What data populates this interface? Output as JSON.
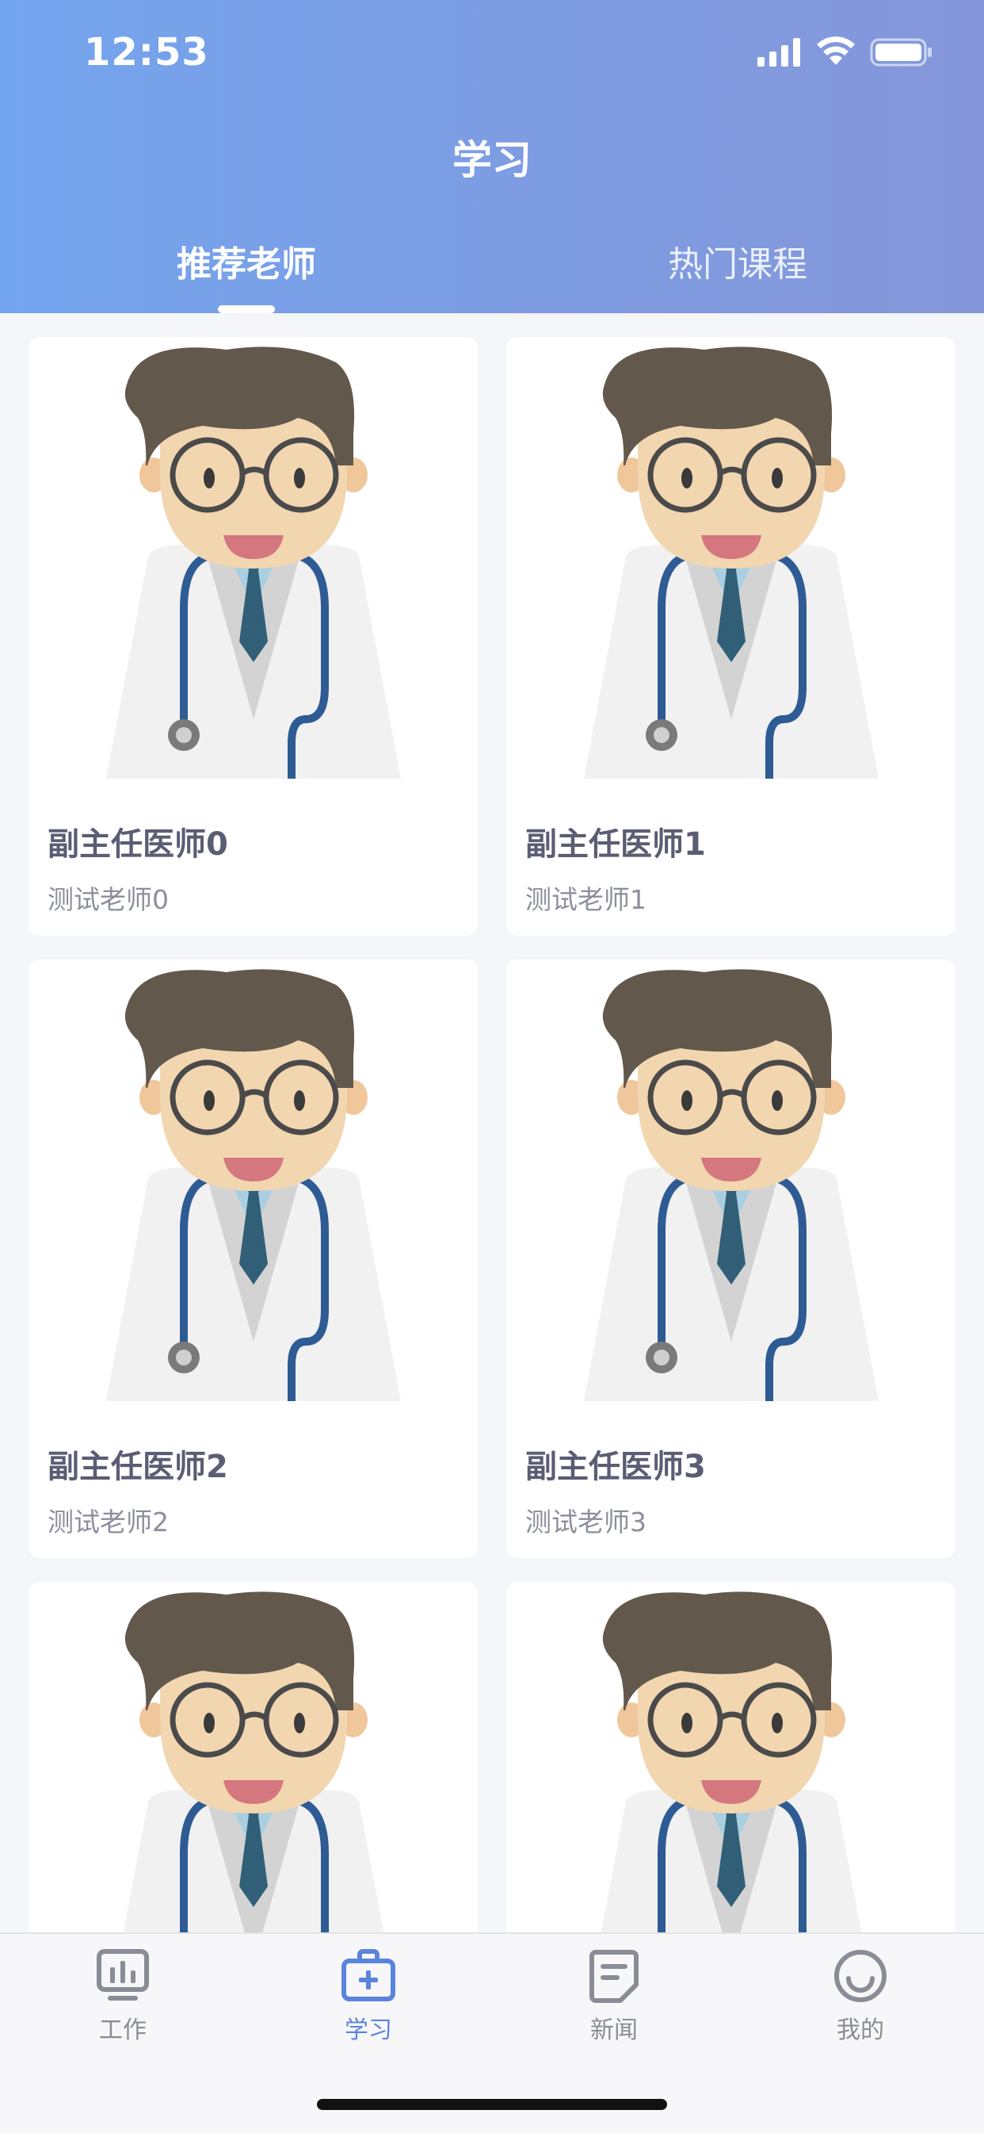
{
  "status_bar": {
    "time": "12:53"
  },
  "header": {
    "title": "学习",
    "tabs": [
      {
        "label": "推荐老师",
        "active": true
      },
      {
        "label": "热门课程",
        "active": false
      }
    ]
  },
  "teachers": [
    {
      "title": "副主任医师0",
      "name": "测试老师0"
    },
    {
      "title": "副主任医师1",
      "name": "测试老师1"
    },
    {
      "title": "副主任医师2",
      "name": "测试老师2"
    },
    {
      "title": "副主任医师3",
      "name": "测试老师3"
    }
  ],
  "tabbar": {
    "items": [
      {
        "label": "工作",
        "icon": "chart-board-icon",
        "active": false
      },
      {
        "label": "学习",
        "icon": "medical-kit-icon",
        "active": true
      },
      {
        "label": "新闻",
        "icon": "document-icon",
        "active": false
      },
      {
        "label": "我的",
        "icon": "smiley-icon",
        "active": false
      }
    ]
  },
  "colors": {
    "header_gradient_start": "#73a5ee",
    "header_gradient_end": "#8597da",
    "active_tab": "#5b84dc"
  }
}
